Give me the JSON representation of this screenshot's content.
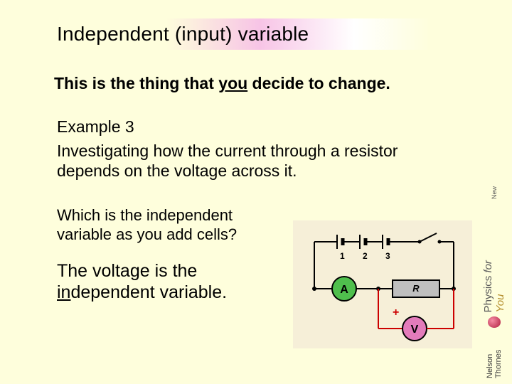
{
  "title": {
    "t1": "Independent",
    "t2": "(input)",
    "t3": "variable"
  },
  "lead": {
    "p1": "This is the thing that ",
    "you": "you",
    "p2": " decide to change."
  },
  "example": {
    "label": "Example 3",
    "desc": "Investigating how the current through a resistor depends on the voltage across it."
  },
  "question": "Which is the independent variable as you add cells?",
  "answer": {
    "a1": "The voltage is the ",
    "under": "in",
    "a2": "dependent variable."
  },
  "circuit": {
    "cells": [
      "1",
      "2",
      "3"
    ],
    "ammeter": "A",
    "resistor": "R",
    "voltmeter": "V",
    "plus": "+"
  },
  "branding": {
    "physics": "Physics",
    "for": "for",
    "you": "You",
    "new": "New",
    "publisher": "Nelson Thornes"
  }
}
